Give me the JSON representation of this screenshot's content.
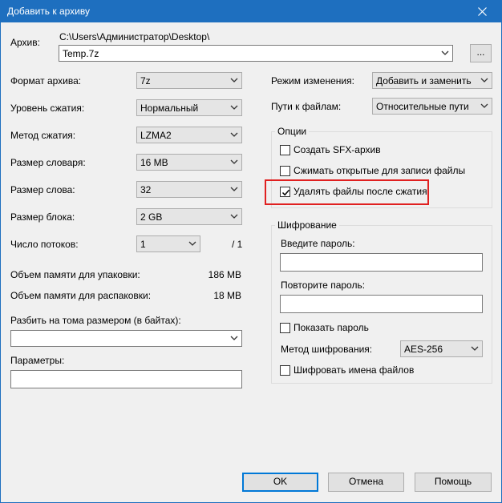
{
  "window": {
    "title": "Добавить к архиву"
  },
  "archive": {
    "label": "Архив:",
    "path": "C:\\Users\\Администратор\\Desktop\\",
    "filename": "Temp.7z",
    "browse_label": "..."
  },
  "left": {
    "format": {
      "label": "Формат архива:",
      "value": "7z"
    },
    "level": {
      "label": "Уровень сжатия:",
      "value": "Нормальный"
    },
    "method": {
      "label": "Метод сжатия:",
      "value": "LZMA2"
    },
    "dict": {
      "label": "Размер словаря:",
      "value": "16 MB"
    },
    "word": {
      "label": "Размер слова:",
      "value": "32"
    },
    "block": {
      "label": "Размер блока:",
      "value": "2 GB"
    },
    "threads": {
      "label": "Число потоков:",
      "value": "1",
      "max": "/ 1"
    },
    "mem_pack": {
      "label": "Объем памяти для упаковки:",
      "value": "186 MB"
    },
    "mem_unpack": {
      "label": "Объем памяти для распаковки:",
      "value": "18 MB"
    },
    "split": {
      "label": "Разбить на тома размером (в байтах):",
      "value": ""
    },
    "params": {
      "label": "Параметры:",
      "value": ""
    }
  },
  "right": {
    "update": {
      "label": "Режим изменения:",
      "value": "Добавить и заменить"
    },
    "paths": {
      "label": "Пути к файлам:",
      "value": "Относительные пути"
    },
    "options": {
      "title": "Опции",
      "sfx": {
        "label": "Создать SFX-архив",
        "checked": false
      },
      "shared": {
        "label": "Сжимать открытые для записи файлы",
        "checked": false
      },
      "delete": {
        "label": "Удалять файлы после сжатия",
        "checked": true
      }
    },
    "encryption": {
      "title": "Шифрование",
      "password_label": "Введите пароль:",
      "password_value": "",
      "repeat_label": "Повторите пароль:",
      "repeat_value": "",
      "show_label": "Показать пароль",
      "method_label": "Метод шифрования:",
      "method_value": "AES-256",
      "encrypt_names_label": "Шифровать имена файлов"
    }
  },
  "buttons": {
    "ok": "OK",
    "cancel": "Отмена",
    "help": "Помощь"
  },
  "colors": {
    "titlebar": "#1e6fbf",
    "highlight": "#e02020",
    "default_button": "#0078d7"
  }
}
